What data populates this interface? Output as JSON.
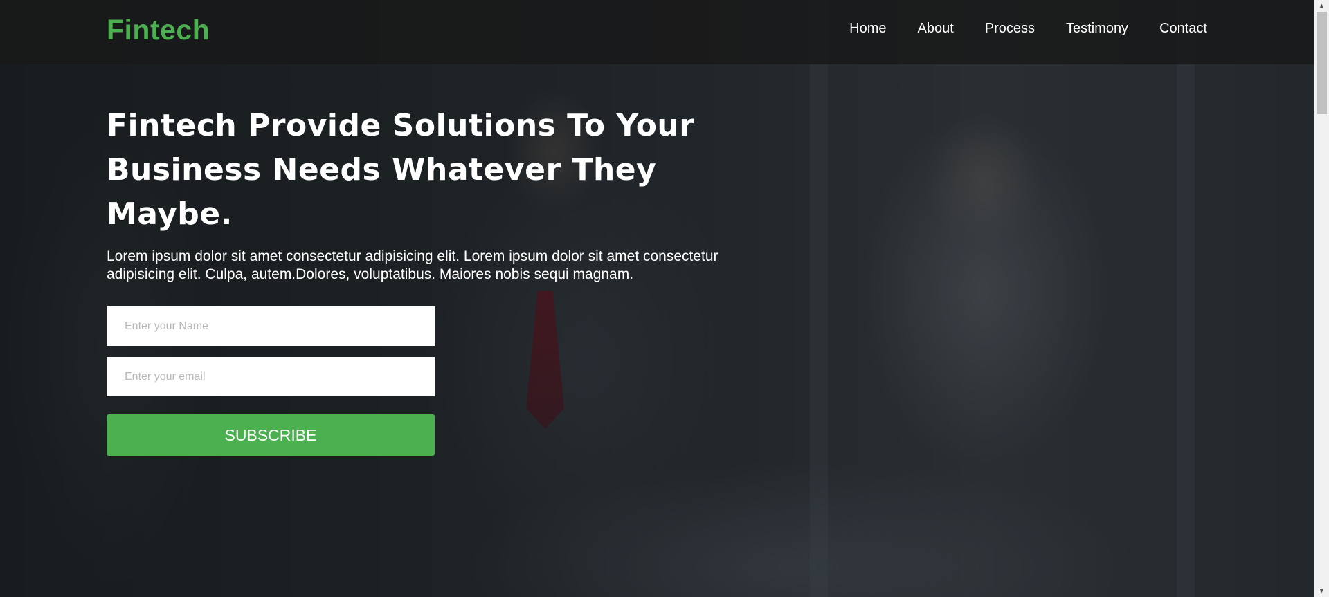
{
  "header": {
    "logo": "Fintech",
    "nav": [
      "Home",
      "About",
      "Process",
      "Testimony",
      "Contact"
    ]
  },
  "hero": {
    "title": "Fintech Provide Solutions To Your Business Needs Whatever They Maybe.",
    "text": "Lorem ipsum dolor sit amet consectetur adipisicing elit. Lorem ipsum dolor sit amet consectetur adipisicing elit. Culpa, autem.Dolores, voluptatibus. Maiores nobis sequi magnam."
  },
  "form": {
    "name_placeholder": "Enter your Name",
    "email_placeholder": "Enter your email",
    "subscribe_label": "SUBSCRIBE"
  },
  "colors": {
    "accent": "#4caf50",
    "header_bg": "#191919",
    "text": "#ffffff"
  },
  "scrollbar": {
    "up_icon": "▲",
    "down_icon": "▼"
  }
}
